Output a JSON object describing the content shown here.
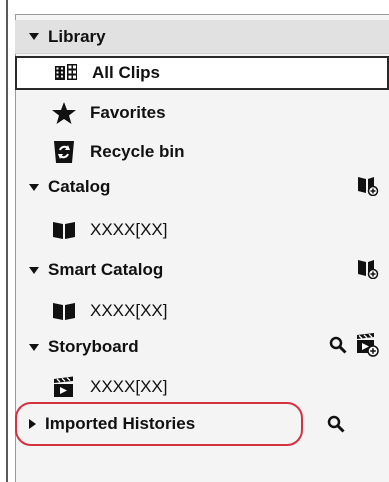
{
  "library": {
    "header": "Library",
    "items": [
      {
        "label": "All Clips",
        "icon": "all-clips-icon",
        "selected": true
      },
      {
        "label": "Favorites",
        "icon": "star-icon",
        "selected": false
      },
      {
        "label": "Recycle bin",
        "icon": "recycle-bin-icon",
        "selected": false
      }
    ]
  },
  "catalog": {
    "header": "Catalog",
    "action_icon": "new-catalog-icon",
    "item": "XXXX[XX]"
  },
  "smart_catalog": {
    "header": "Smart Catalog",
    "action_icon": "new-smart-catalog-icon",
    "item": "XXXX[XX]"
  },
  "storyboard": {
    "header": "Storyboard",
    "action_icons": [
      "search-icon",
      "new-storyboard-icon"
    ],
    "item": "XXXX[XX]"
  },
  "imported_histories": {
    "header": "Imported Histories",
    "action_icon": "search-icon",
    "collapsed": true
  },
  "colors": {
    "highlight": "#d6313f",
    "header_bg": "#e1e1e1",
    "panel_bg": "#f4f4f4"
  }
}
